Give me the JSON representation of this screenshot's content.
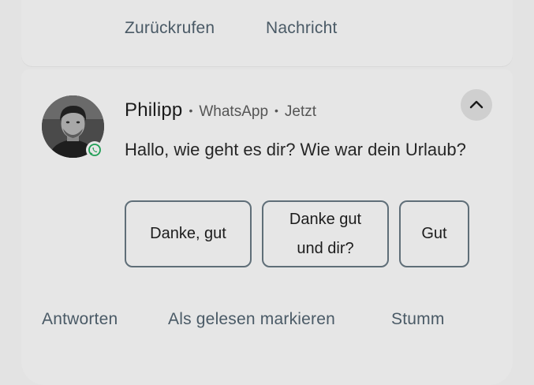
{
  "previous_notification": {
    "actions": {
      "call_back": "Zurückrufen",
      "message": "Nachricht"
    }
  },
  "notification": {
    "sender": "Philipp",
    "app": "WhatsApp",
    "time": "Jetzt",
    "message": "Hallo, wie geht es dir? Wie war dein Urlaub?",
    "separator": "•",
    "smart_replies": [
      {
        "line1": "Danke, gut",
        "line2": ""
      },
      {
        "line1": "Danke gut",
        "line2": "und dir?"
      },
      {
        "line1": "Gut",
        "line2": ""
      }
    ],
    "actions": {
      "reply": "Antworten",
      "mark_read": "Als gelesen markieren",
      "mute": "Stumm"
    }
  },
  "colors": {
    "background": "#e3e3e3",
    "card": "#e6e6e6",
    "action_text": "#4a5a66",
    "chip_border": "#5f6e78",
    "whatsapp_green": "#1e9e54"
  },
  "icons": {
    "expand": "chevron-up-icon",
    "app_badge": "whatsapp-icon"
  }
}
